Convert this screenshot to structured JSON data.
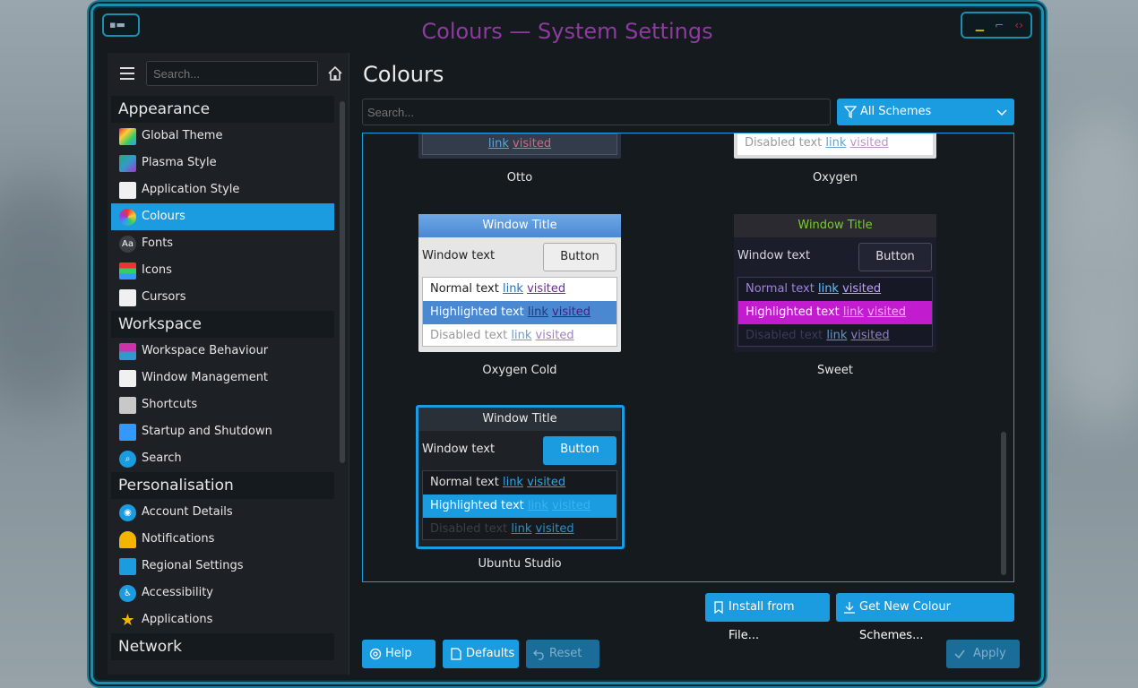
{
  "window": {
    "title": "Colours — System Settings"
  },
  "sidebar": {
    "search_placeholder": "Search...",
    "categories": [
      {
        "label": "Appearance",
        "items": [
          {
            "label": "Global Theme",
            "icon": "global-theme-icon"
          },
          {
            "label": "Plasma Style",
            "icon": "plasma-style-icon"
          },
          {
            "label": "Application Style",
            "icon": "application-style-icon"
          },
          {
            "label": "Colours",
            "icon": "colours-icon",
            "active": true
          },
          {
            "label": "Fonts",
            "icon": "fonts-icon"
          },
          {
            "label": "Icons",
            "icon": "icons-icon"
          },
          {
            "label": "Cursors",
            "icon": "cursors-icon"
          }
        ]
      },
      {
        "label": "Workspace",
        "items": [
          {
            "label": "Workspace Behaviour",
            "icon": "workspace-behaviour-icon"
          },
          {
            "label": "Window Management",
            "icon": "window-management-icon"
          },
          {
            "label": "Shortcuts",
            "icon": "keyboard-icon"
          },
          {
            "label": "Startup and Shutdown",
            "icon": "startup-icon"
          },
          {
            "label": "Search",
            "icon": "search-icon"
          }
        ]
      },
      {
        "label": "Personalisation",
        "items": [
          {
            "label": "Account Details",
            "icon": "account-icon"
          },
          {
            "label": "Notifications",
            "icon": "bell-icon"
          },
          {
            "label": "Regional Settings",
            "icon": "regional-icon"
          },
          {
            "label": "Accessibility",
            "icon": "accessibility-icon"
          },
          {
            "label": "Applications",
            "icon": "star-icon"
          }
        ]
      },
      {
        "label": "Network",
        "items": []
      }
    ]
  },
  "main": {
    "title": "Colours",
    "search_placeholder": "Search...",
    "filter_label": "All Schemes",
    "schemes": [
      {
        "name": "Otto",
        "partial": "top",
        "link": "link",
        "visited": "visited"
      },
      {
        "name": "Oxygen",
        "partial": "top",
        "disabled_text": "Disabled text",
        "link": "link",
        "visited": "visited"
      },
      {
        "name": "Oxygen Cold",
        "window_title": "Window Title",
        "window_text": "Window text",
        "button": "Button",
        "normal_text": "Normal text",
        "highlighted_text": "Highlighted text",
        "disabled_text": "Disabled text",
        "link": "link",
        "visited": "visited"
      },
      {
        "name": "Sweet",
        "window_title": "Window Title",
        "window_text": "Window text",
        "button": "Button",
        "normal_text": "Normal text",
        "highlighted_text": "Highlighted text",
        "disabled_text": "Disabled text",
        "link": "link",
        "visited": "visited"
      },
      {
        "name": "Ubuntu Studio",
        "selected": true,
        "window_title": "Window Title",
        "window_text": "Window text",
        "button": "Button",
        "normal_text": "Normal text",
        "highlighted_text": "Highlighted text",
        "disabled_text": "Disabled text",
        "link": "link",
        "visited": "visited"
      }
    ],
    "install_button": "Install from File...",
    "get_new_button": "Get New Colour Schemes...",
    "help_button": "Help",
    "defaults_button": "Defaults",
    "reset_button": "Reset",
    "apply_button": "Apply"
  },
  "colors": {
    "accent": "#1b9be0",
    "title_purple": "#8f3aa0",
    "window_border": "#1a8fb0"
  }
}
